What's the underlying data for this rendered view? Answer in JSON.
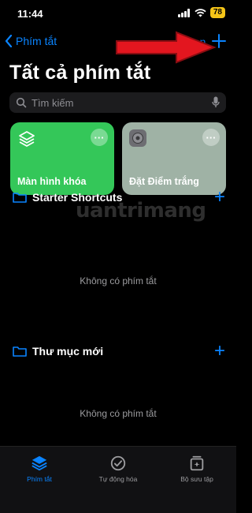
{
  "status_bar": {
    "time": "11:44",
    "battery": "78"
  },
  "nav": {
    "back_label": "Phím tắt",
    "select_label": "Chọn"
  },
  "title": "Tất cả phím tắt",
  "search": {
    "placeholder": "Tìm kiếm"
  },
  "cards": [
    {
      "label": "Màn hình khóa",
      "color": "#34c759"
    },
    {
      "label": "Đặt Điểm trắng",
      "color": "#9fb2a5"
    }
  ],
  "folders": [
    {
      "name": "Starter Shortcuts",
      "empty_text": "Không có phím tắt"
    },
    {
      "name": "Thư mục mới",
      "empty_text": "Không có phím tắt"
    }
  ],
  "watermark": "uantrimang",
  "tabbar": {
    "tabs": [
      {
        "label": "Phím tắt",
        "active": true
      },
      {
        "label": "Tự động hóa",
        "active": false
      },
      {
        "label": "Bộ sưu tập",
        "active": false
      }
    ]
  },
  "colors": {
    "accent": "#0a84ff",
    "background": "#000000",
    "annotation_arrow": "#e3161f"
  }
}
